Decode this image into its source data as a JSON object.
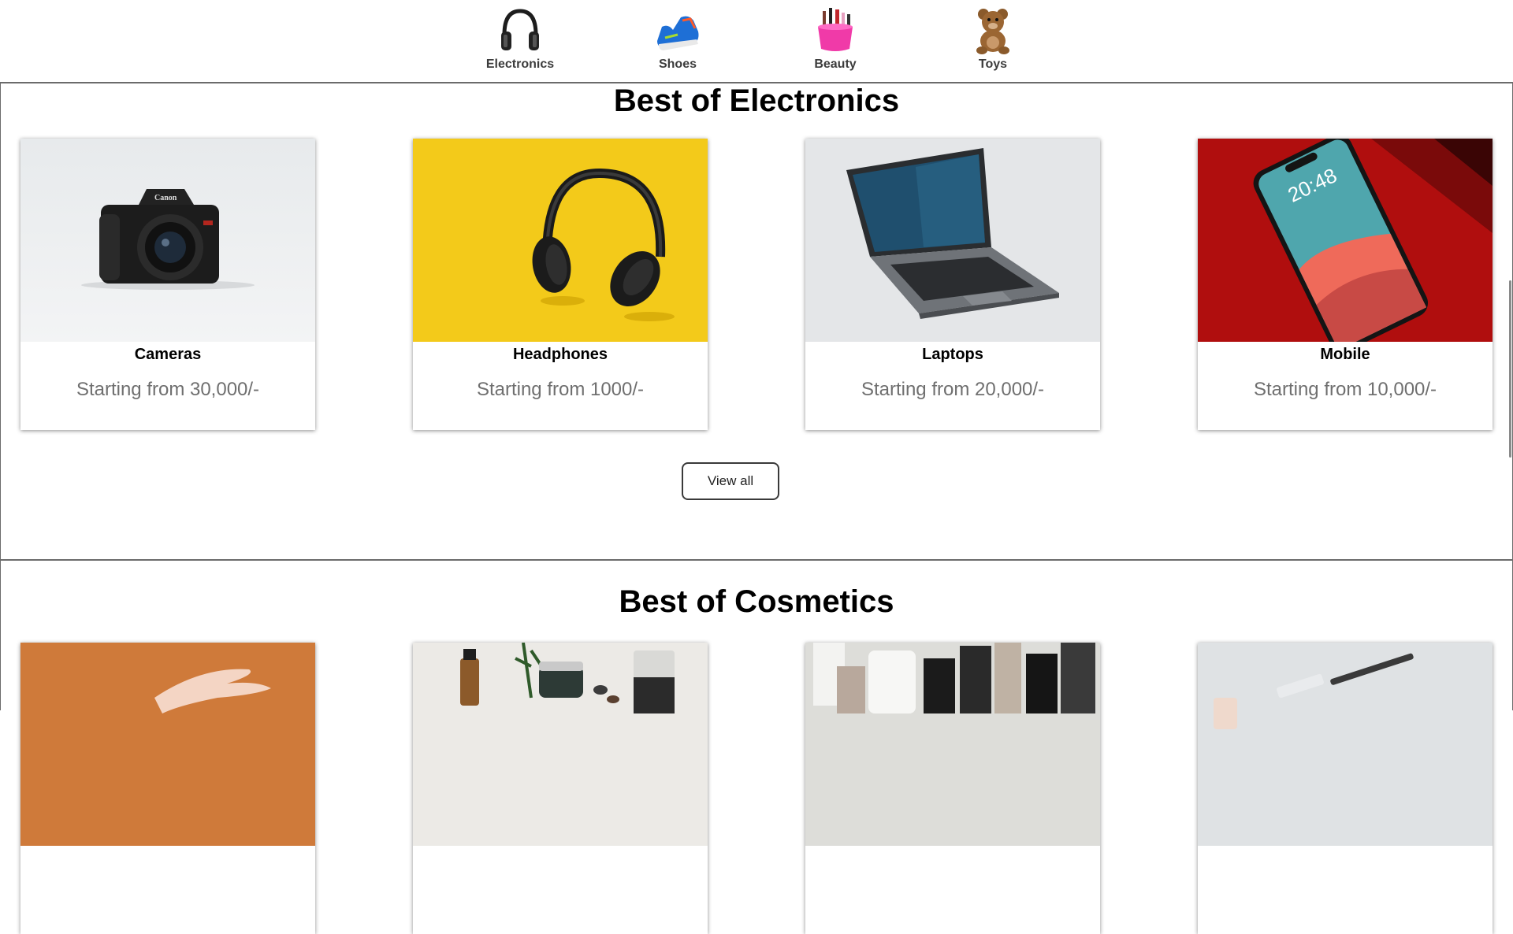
{
  "nav": {
    "categories": [
      {
        "label": "Electronics",
        "icon": "headphones-icon"
      },
      {
        "label": "Shoes",
        "icon": "sneaker-icon"
      },
      {
        "label": "Beauty",
        "icon": "cosmetics-icon"
      },
      {
        "label": "Toys",
        "icon": "teddy-bear-icon"
      }
    ]
  },
  "electronics": {
    "title": "Best of Electronics",
    "products": [
      {
        "name": "Cameras",
        "price": "Starting from 30,000/-"
      },
      {
        "name": "Headphones",
        "price": "Starting from 1000/-"
      },
      {
        "name": "Laptops",
        "price": "Starting from 20,000/-"
      },
      {
        "name": "Mobile",
        "price": "Starting from 10,000/-"
      }
    ],
    "view_all_label": "View all"
  },
  "cosmetics": {
    "title": "Best of Cosmetics"
  },
  "phone_screen": {
    "time": "20:48"
  },
  "colors": {
    "border": "#6b6b6b",
    "price_text": "#6f6f6f",
    "headphones_bg": "#f2c300",
    "mobile_bg": "#b00e0e"
  }
}
